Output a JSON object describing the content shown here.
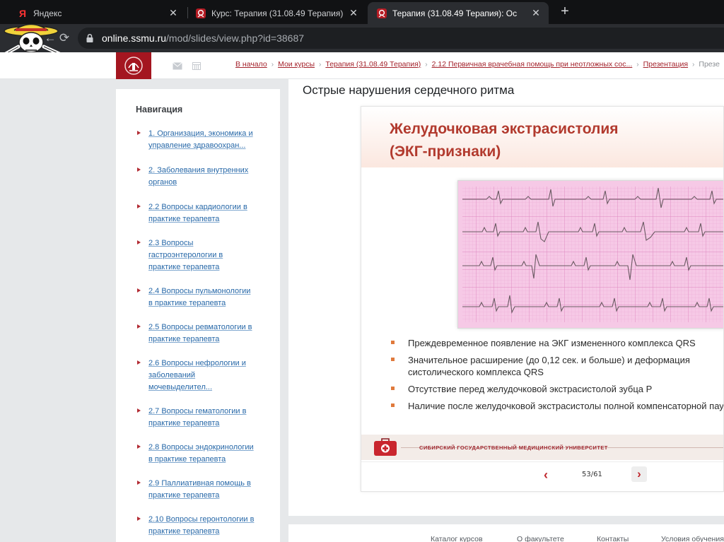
{
  "browser": {
    "tabs": [
      {
        "title": "Яндекс",
        "favicon": "Я"
      },
      {
        "title": "Курс: Терапия (31.08.49 Терапия)",
        "favicon": "ssmu-crest-icon"
      },
      {
        "title": "Терапия (31.08.49 Терапия): Ос",
        "favicon": "ssmu-crest-icon"
      }
    ],
    "new_tab": "+",
    "close_glyph": "✕",
    "back_glyph": "←",
    "reload_glyph": "⟳",
    "url_host": "online.ssmu.ru",
    "url_path": "/mod/slides/view.php?id=38687"
  },
  "header": {
    "breadcrumbs": [
      "В начало",
      "Мои курсы",
      "Терапия (31.08.49 Терапия)",
      "2.12 Первичная врачебная помощь при неотложных сос...",
      "Презентация",
      "Презе"
    ],
    "separator": "›"
  },
  "navigation": {
    "title": "Навигация",
    "items": [
      [
        "1. Организация, экономика и",
        "управление здравоохран..."
      ],
      [
        "2. Заболевания внутренних",
        "органов"
      ],
      [
        "2.2 Вопросы кардиологии в",
        "практике терапевта"
      ],
      [
        "2.3 Вопросы",
        "гастроэнтерологии в",
        "практике терапевта"
      ],
      [
        "2.4 Вопросы пульмонологии",
        "в практике терапевта"
      ],
      [
        "2.5 Вопросы ревматологии в",
        "практике терапевта"
      ],
      [
        "2.6 Вопросы нефрологии и",
        "заболеваний",
        "мочевыделител..."
      ],
      [
        "2.7 Вопросы гематологии в",
        "практике терапевта"
      ],
      [
        "2.8 Вопросы эндокринологии",
        "в практике терапевта"
      ],
      [
        "2.9 Паллиативная помощь в",
        "практике терапевта"
      ],
      [
        "2.10 Вопросы геронтологии в",
        "практике терапевта"
      ]
    ]
  },
  "main": {
    "page_title": "Острые нарушения сердечного ритма",
    "slide": {
      "title_line1": "Желудочковая экстрасистолия",
      "title_line2": "(ЭКГ-признаки)",
      "bullets": [
        [
          "Преждевременное появление на ЭКГ измененного комплекса QRS"
        ],
        [
          "Значительное расширение (до 0,12 сек. и больше) и деформация",
          "систолического комплекса QRS"
        ],
        [
          "Отсутствие перед желудочковой экстрасистолой зубца P"
        ],
        [
          "Наличие после желудочковой экстрасистолы полной компенсаторной паузы"
        ]
      ],
      "university": "СИБИРСКИЙ ГОСУДАРСТВЕННЫЙ МЕДИЦИНСКИЙ УНИВЕРСИТЕТ",
      "accent_color": "#b23a2e"
    },
    "pager": {
      "prev": "‹",
      "next": "›",
      "counter": "53/61"
    }
  },
  "footer": {
    "links": [
      "Каталог курсов",
      "О факультете",
      "Контакты",
      "Условия обучения"
    ]
  }
}
